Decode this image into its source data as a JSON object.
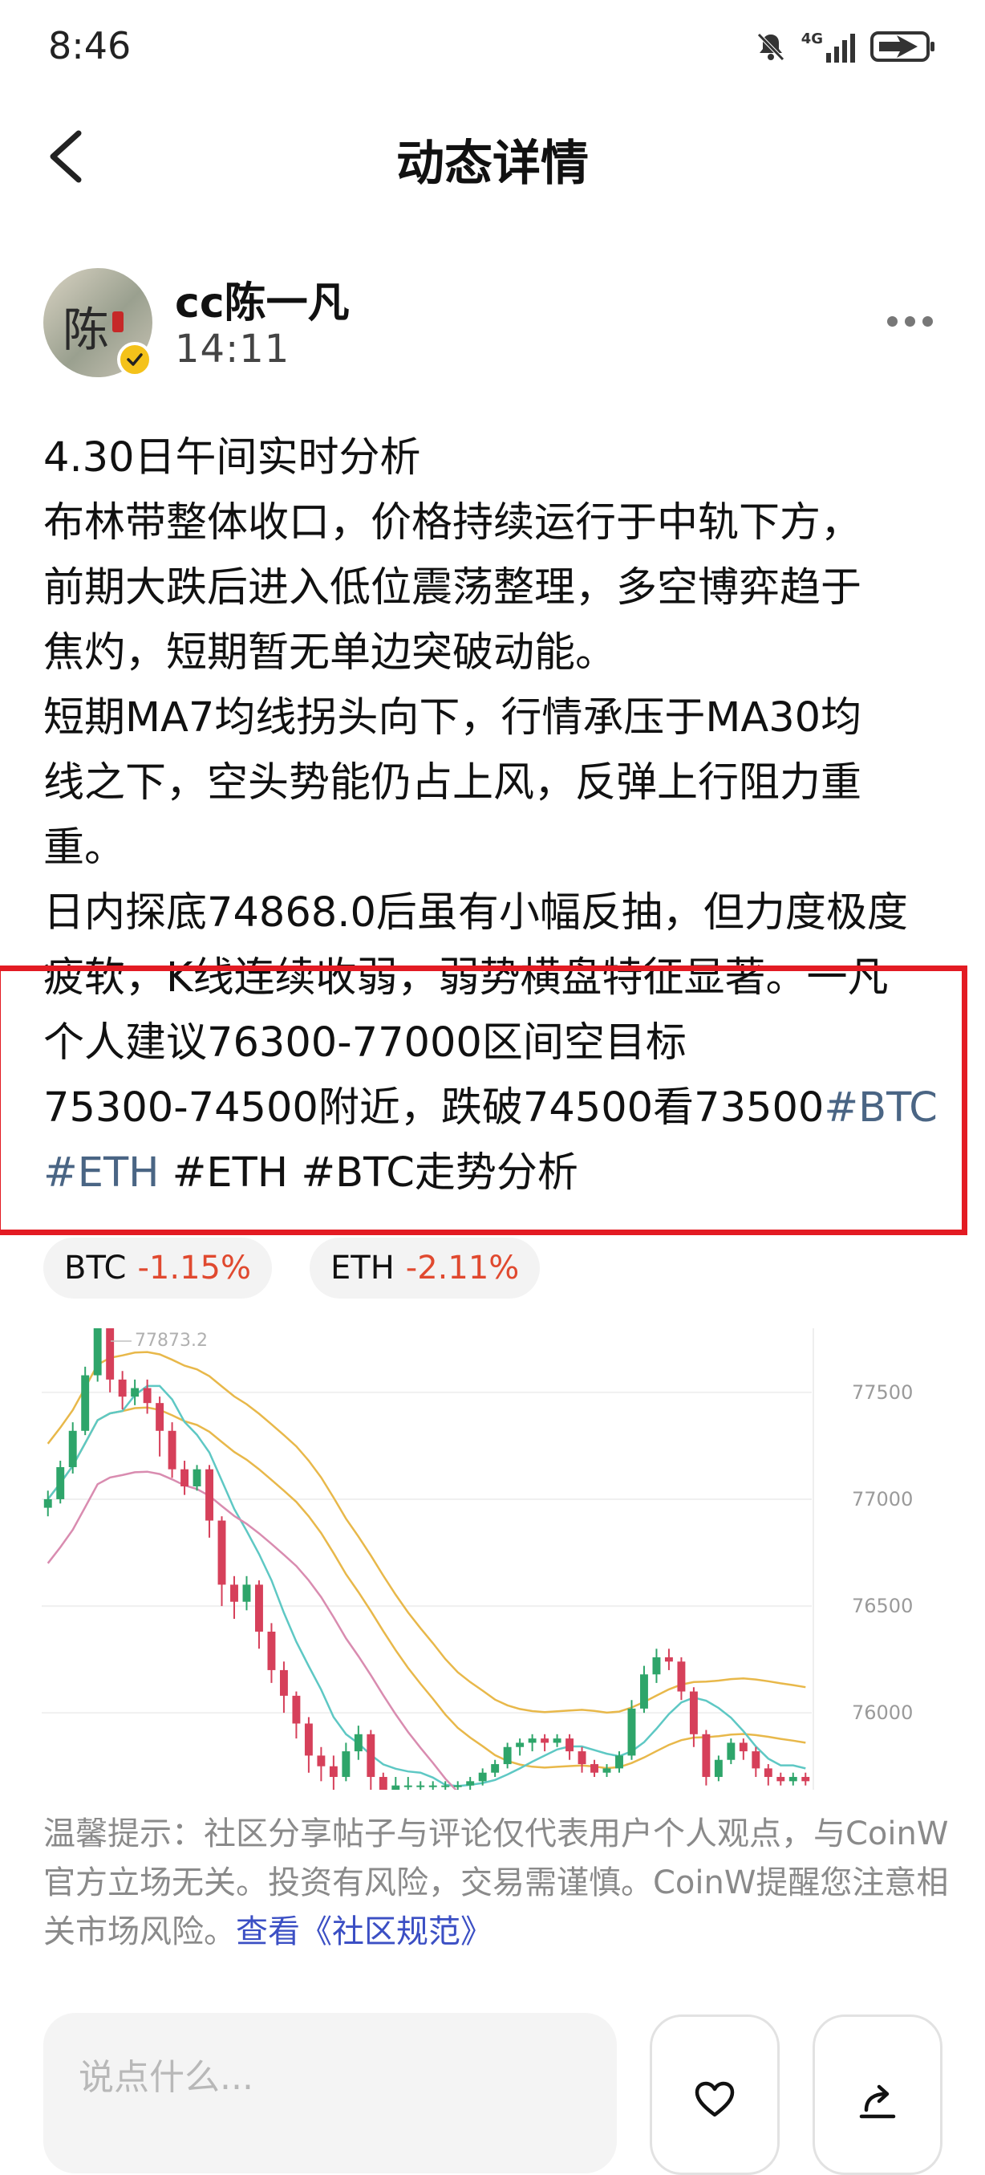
{
  "status_bar": {
    "time": "8:46",
    "network": "4G",
    "icons": [
      "mute-bell-icon",
      "signal-icon",
      "battery-charging-icon"
    ]
  },
  "header": {
    "title": "动态详情",
    "back_icon": "chevron-left-icon"
  },
  "author": {
    "name": "cc陈一凡",
    "time": "14:11",
    "avatar_char": "陈",
    "verified_color": "#f4c21a"
  },
  "post": {
    "lines": [
      [
        {
          "t": "4.30日午间实时分析"
        }
      ],
      [
        {
          "t": "布林带整体收口，价格持续运行于中轨下方，"
        }
      ],
      [
        {
          "t": "前期大跌后进入低位震荡整理，多空博弈趋于"
        }
      ],
      [
        {
          "t": "焦灼，短期暂无单边突破动能。"
        }
      ],
      [
        {
          "t": "短期MA7均线拐头向下，行情承压于MA30均"
        }
      ],
      [
        {
          "t": "线之下，空头势能仍占上风，反弹上行阻力重"
        }
      ],
      [
        {
          "t": "重。"
        }
      ],
      [
        {
          "t": "日内探底74868.0后虽有小幅反抽，但力度极度"
        }
      ],
      [
        {
          "t": "疲软，K线连续收弱，弱势横盘特征显著。一凡"
        }
      ],
      [
        {
          "t": "个人建议76300-77000区间空目标"
        }
      ],
      [
        {
          "t": "75300-74500附近，跌破74500看73500"
        },
        {
          "t": "#BTC",
          "tag": true
        }
      ],
      [
        {
          "t": "#ETH",
          "tag": true
        },
        {
          "t": " #ETH #BTC走势分析"
        }
      ]
    ]
  },
  "coins": [
    {
      "symbol": "BTC",
      "change": "-1.15%"
    },
    {
      "symbol": "ETH",
      "change": "-2.11%"
    }
  ],
  "chart_data": {
    "type": "line",
    "chart_kind": "candlestick with MA and Bollinger bands",
    "y_ticks": [
      "77500",
      "77000",
      "76500",
      "76000"
    ],
    "ylim": [
      75640,
      77800
    ],
    "high_label": "77873.2",
    "colors": {
      "up": "#2ea56a",
      "down": "#d6405a",
      "ma_a": "#e8b84a",
      "ma_b": "#5ec8c4",
      "ma_c": "#d98cb0"
    },
    "candles": [
      [
        76960,
        77000,
        76920,
        77040
      ],
      [
        77000,
        77150,
        76980,
        77180
      ],
      [
        77150,
        77320,
        77120,
        77360
      ],
      [
        77320,
        77580,
        77300,
        77620
      ],
      [
        77580,
        77800,
        77550,
        77873
      ],
      [
        77800,
        77560,
        77500,
        77820
      ],
      [
        77560,
        77480,
        77420,
        77600
      ],
      [
        77480,
        77520,
        77440,
        77560
      ],
      [
        77520,
        77450,
        77400,
        77560
      ],
      [
        77450,
        77320,
        77200,
        77480
      ],
      [
        77320,
        77140,
        77100,
        77360
      ],
      [
        77140,
        77060,
        77020,
        77180
      ],
      [
        77060,
        77140,
        77040,
        77160
      ],
      [
        77140,
        76900,
        76820,
        77160
      ],
      [
        76900,
        76600,
        76500,
        76920
      ],
      [
        76600,
        76520,
        76440,
        76640
      ],
      [
        76520,
        76600,
        76480,
        76640
      ],
      [
        76600,
        76380,
        76300,
        76620
      ],
      [
        76380,
        76200,
        76140,
        76420
      ],
      [
        76200,
        76080,
        76000,
        76240
      ],
      [
        76080,
        75950,
        75880,
        76100
      ],
      [
        75950,
        75800,
        75720,
        75980
      ],
      [
        75800,
        75750,
        75680,
        75840
      ],
      [
        75750,
        75700,
        75640,
        75800
      ],
      [
        75700,
        75820,
        75680,
        75860
      ],
      [
        75820,
        75900,
        75780,
        75940
      ],
      [
        75900,
        75700,
        75600,
        75920
      ],
      [
        75700,
        75640,
        75600,
        75720
      ],
      [
        75640,
        75660,
        75600,
        75700
      ],
      [
        75660,
        75660,
        75640,
        75700
      ],
      [
        75660,
        75660,
        75640,
        75680
      ],
      [
        75660,
        75660,
        75640,
        75680
      ],
      [
        75660,
        75660,
        75640,
        75680
      ],
      [
        75660,
        75660,
        75640,
        75680
      ],
      [
        75660,
        75680,
        75640,
        75700
      ],
      [
        75680,
        75720,
        75660,
        75740
      ],
      [
        75720,
        75760,
        75700,
        75780
      ],
      [
        75760,
        75840,
        75740,
        75860
      ],
      [
        75840,
        75860,
        75800,
        75880
      ],
      [
        75860,
        75880,
        75820,
        75900
      ],
      [
        75880,
        75860,
        75820,
        75900
      ],
      [
        75860,
        75880,
        75840,
        75900
      ],
      [
        75880,
        75820,
        75780,
        75900
      ],
      [
        75820,
        75760,
        75720,
        75840
      ],
      [
        75760,
        75720,
        75700,
        75780
      ],
      [
        75720,
        75740,
        75700,
        75760
      ],
      [
        75740,
        75800,
        75720,
        75820
      ],
      [
        75800,
        76020,
        75780,
        76060
      ],
      [
        76020,
        76180,
        76000,
        76220
      ],
      [
        76180,
        76260,
        76140,
        76300
      ],
      [
        76260,
        76240,
        76200,
        76300
      ],
      [
        76240,
        76100,
        76060,
        76260
      ],
      [
        76100,
        75900,
        75840,
        76120
      ],
      [
        75900,
        75700,
        75660,
        75920
      ],
      [
        75700,
        75780,
        75680,
        75800
      ],
      [
        75780,
        75860,
        75760,
        75880
      ],
      [
        75860,
        75820,
        75780,
        75880
      ],
      [
        75820,
        75740,
        75700,
        75840
      ],
      [
        75740,
        75700,
        75660,
        75760
      ],
      [
        75700,
        75680,
        75660,
        75720
      ],
      [
        75680,
        75700,
        75660,
        75720
      ],
      [
        75700,
        75680,
        75660,
        75720
      ]
    ]
  },
  "disclaimer": {
    "text": "温馨提示：社区分享帖子与评论仅代表用户个人观点，与CoinW官方立场无关。投资有风险，交易需谨慎。CoinW提醒您注意相关市场风险。",
    "link": "查看《社区规范》"
  },
  "bottom_bar": {
    "placeholder": "说点什么...",
    "like_icon": "heart-icon",
    "share_icon": "share-icon"
  }
}
